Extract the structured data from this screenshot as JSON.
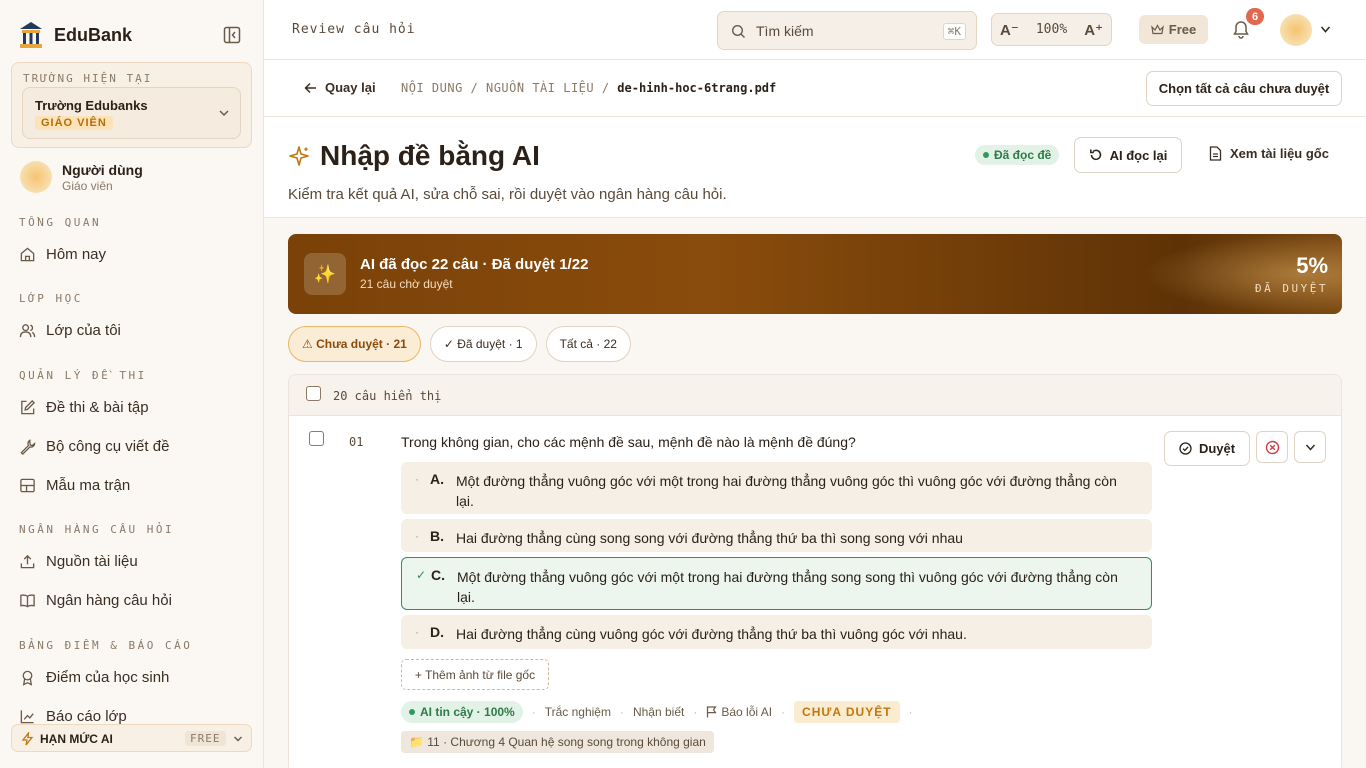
{
  "brand": {
    "name": "EduBank"
  },
  "school": {
    "caption": "TRƯỜNG HIỆN TẠI",
    "name": "Trường Edubanks",
    "role": "GIÁO VIÊN"
  },
  "user": {
    "name": "Người dùng",
    "role": "Giáo viên"
  },
  "nav": {
    "sections": [
      "TỔNG QUAN",
      "LỚP HỌC",
      "QUẢN LÝ ĐỀ THI",
      "NGÂN HÀNG CÂU HỎI",
      "BẢNG ĐIỂM & BÁO CÁO"
    ],
    "items": [
      "Hôm nay",
      "Lớp của tôi",
      "Đề thi & bài tập",
      "Bộ công cụ viết đề",
      "Mẫu ma trận",
      "Nguồn tài liệu",
      "Ngân hàng câu hỏi",
      "Điểm của học sinh",
      "Báo cáo lớp"
    ]
  },
  "quota": {
    "label": "HẠN MỨC AI",
    "badge": "FREE"
  },
  "topbar": {
    "page_label": "Review câu hỏi",
    "search_placeholder": "Tìm kiếm",
    "search_shortcut": "⌘K",
    "zoom_minus": "A⁻",
    "zoom_value": "100%",
    "zoom_plus": "A⁺",
    "plan": "Free",
    "notifications": "6"
  },
  "breadcrumb": {
    "back": "Quay lại",
    "path": "NỘI DUNG / NGUỒN TÀI LIỆU / ",
    "file": "de-hinh-hoc-6trang.pdf",
    "select_all": "Chọn tất cả câu chưa duyệt"
  },
  "header": {
    "title": "Nhập đề bằng AI",
    "subtitle": "Kiểm tra kết quả AI, sửa chỗ sai, rồi duyệt vào ngân hàng câu hỏi.",
    "read_badge": "Đã đọc đề",
    "reread": "AI đọc lại",
    "view_source": "Xem tài liệu gốc"
  },
  "banner": {
    "title": "AI đã đọc 22 câu · Đã duyệt 1/22",
    "subtitle": "21 câu chờ duyệt",
    "percent": "5%",
    "percent_label": "ĐÃ DUYỆT",
    "icon": "✨"
  },
  "filters": {
    "pending": "⚠ Chưa duyệt · 21",
    "approved": "✓ Đã duyệt · 1",
    "all": "Tất cả · 22"
  },
  "list": {
    "count_label": "20 câu hiển thị"
  },
  "question": {
    "number": "01",
    "text": "Trong không gian, cho các mệnh đề sau, mệnh đề nào là mệnh đề đúng?",
    "options": [
      {
        "letter": "A.",
        "text": "Một đường thẳng vuông góc với một trong hai đường thẳng vuông góc thì vuông góc với đường thẳng còn lại.",
        "mark": "·"
      },
      {
        "letter": "B.",
        "text": "Hai đường thẳng cùng song song với đường thẳng thứ ba thì song song với nhau",
        "mark": "·"
      },
      {
        "letter": "C.",
        "text": "Một đường thẳng vuông góc với một trong hai đường thẳng song song thì vuông góc với đường thẳng còn lại.",
        "mark": "✓"
      },
      {
        "letter": "D.",
        "text": "Hai đường thẳng cùng vuông góc với đường thẳng thứ ba thì vuông góc với nhau.",
        "mark": "·"
      }
    ],
    "add_image": "+ Thêm ảnh từ file gốc",
    "confidence": "AI tin cậy · 100%",
    "type": "Trắc nghiệm",
    "level": "Nhận biết",
    "report": "Báo lỗi AI",
    "status": "CHƯA DUYỆT",
    "chapter": "📁 11 · Chương 4 Quan hệ song song trong không gian",
    "approve": "Duyệt"
  }
}
